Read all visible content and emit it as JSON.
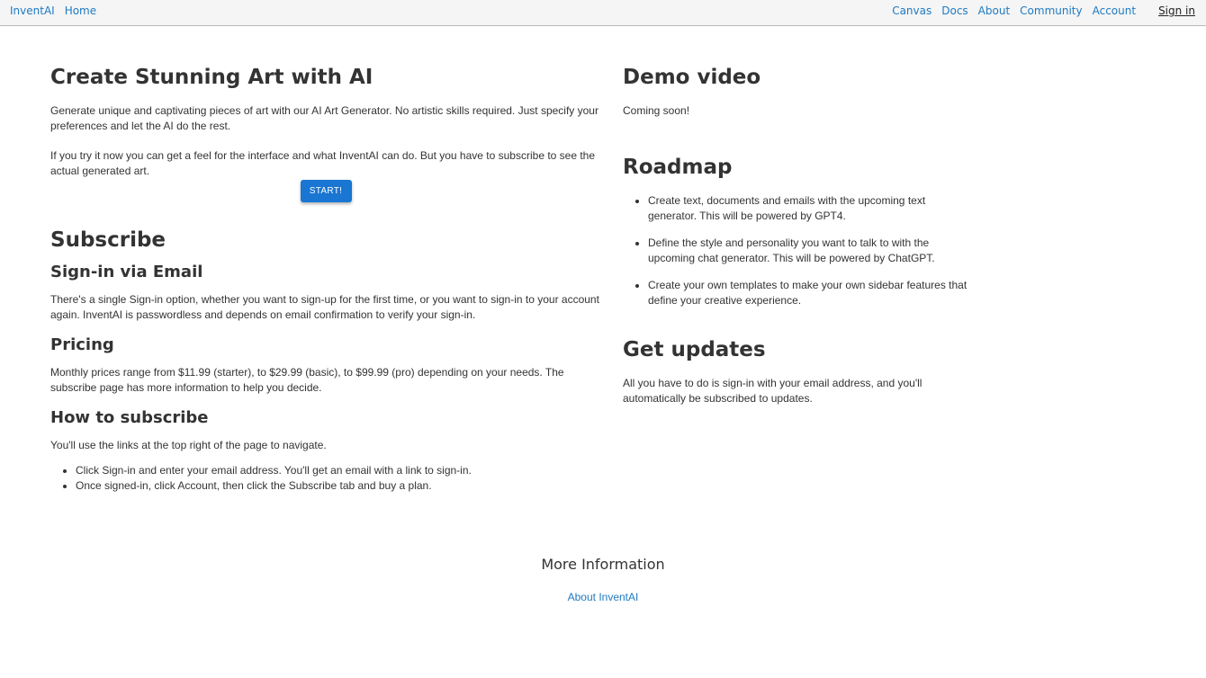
{
  "nav": {
    "brand": "InventAI",
    "home": "Home",
    "canvas": "Canvas",
    "docs": "Docs",
    "about": "About",
    "community": "Community",
    "account": "Account",
    "sign_in": "Sign in"
  },
  "hero": {
    "title": "Create Stunning Art with AI",
    "para1": "Generate unique and captivating pieces of art with our AI Art Generator. No artistic skills required. Just specify your preferences and let the AI do the rest.",
    "para2": "If you try it now you can get a feel for the interface and what InventAI can do. But you have to subscribe to see the actual generated art.",
    "start_label": "START!"
  },
  "subscribe": {
    "title": "Subscribe",
    "signin_heading": "Sign-in via Email",
    "signin_text": "There's a single Sign-in option, whether you want to sign-up for the first time, or you want to sign-in to your account again. InventAI is passwordless and depends on email confirmation to verify your sign-in.",
    "pricing_heading": "Pricing",
    "pricing_text": "Monthly prices range from $11.99 (starter), to $29.99 (basic), to $99.99 (pro) depending on your needs. The subscribe page has more information to help you decide.",
    "how_heading": "How to subscribe",
    "how_text": "You'll use the links at the top right of the page to navigate.",
    "steps": [
      "Click Sign-in and enter your email address. You'll get an email with a link to sign-in.",
      "Once signed-in, click Account, then click the Subscribe tab and buy a plan."
    ]
  },
  "demo": {
    "title": "Demo video",
    "text": "Coming soon!"
  },
  "roadmap": {
    "title": "Roadmap",
    "items": [
      "Create text, documents and emails with the upcoming text generator. This will be powered by GPT4.",
      "Define the style and personality you want to talk to with the upcoming chat generator. This will be powered by ChatGPT.",
      "Create your own templates to make your own sidebar features that define your creative experience."
    ]
  },
  "updates": {
    "title": "Get updates",
    "text": "All you have to do is sign-in with your email address, and you'll automatically be subscribed to updates."
  },
  "footer": {
    "title": "More Information",
    "link": "About InventAI"
  },
  "colors": {
    "link": "#1f7ac2",
    "button": "#1976d2",
    "text": "#333333",
    "topbar": "#f5f5f5"
  }
}
